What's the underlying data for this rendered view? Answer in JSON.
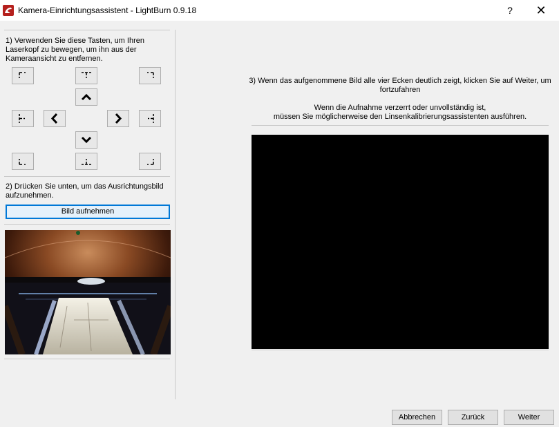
{
  "window": {
    "title": "Kamera-Einrichtungsassistent - LightBurn 0.9.18",
    "help_glyph": "?",
    "close_glyph": "✕"
  },
  "step1": {
    "line1": "1) Verwenden Sie diese Tasten, um Ihren",
    "line2": "Laserkopf zu bewegen, um ihn aus der",
    "line3": "Kameraansicht zu entfernen."
  },
  "jog_buttons": [
    "move-top-left",
    "move-top-center",
    "move-top-right",
    "jog-up",
    "move-middle-left",
    "jog-left",
    "jog-right",
    "move-middle-right",
    "jog-down",
    "move-bottom-left",
    "move-bottom-center",
    "move-bottom-right"
  ],
  "step2": {
    "line1": "2) Drücken Sie unten, um das Ausrichtungsbild",
    "line2": "aufzunehmen.",
    "capture_button": "Bild aufnehmen"
  },
  "step3": {
    "line1": "3) Wenn das aufgenommene Bild alle vier Ecken deutlich zeigt, klicken Sie auf Weiter, um",
    "line2": "fortzufahren",
    "line3": "Wenn die Aufnahme verzerrt oder unvollständig ist,",
    "line4": "müssen Sie möglicherweise den Linsenkalibrierungsassistenten ausführen."
  },
  "footer": {
    "cancel": "Abbrechen",
    "back": "Zurück",
    "next": "Weiter"
  }
}
